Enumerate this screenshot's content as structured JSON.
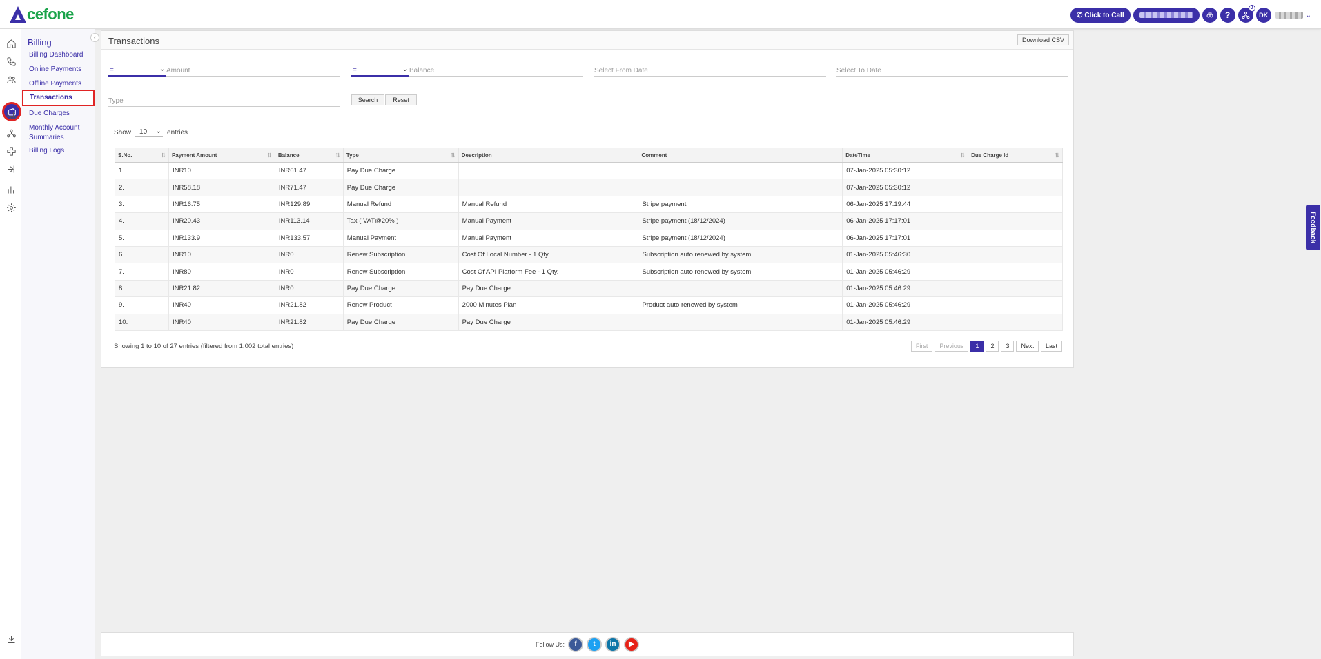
{
  "brand": {
    "logo_text": "cefone",
    "accent": "#3b2fa8",
    "logo_green": "#1aa34a"
  },
  "topbar": {
    "click_to_call": "Click to Call",
    "avatar_initials": "DK",
    "notification_count": "0"
  },
  "subnav": {
    "title": "Billing",
    "items": [
      "Billing Dashboard",
      "Online Payments",
      "Offline Payments",
      "Transactions",
      "Due Charges",
      "Monthly Account Summaries",
      "Billing Logs"
    ]
  },
  "card": {
    "title": "Transactions",
    "download_label": "Download CSV"
  },
  "filters": {
    "amount_op": "=",
    "amount_placeholder": "Amount",
    "balance_op": "=",
    "balance_placeholder": "Balance",
    "from_date_placeholder": "Select From Date",
    "to_date_placeholder": "Select To Date",
    "type_placeholder": "Type",
    "search_label": "Search",
    "reset_label": "Reset"
  },
  "length": {
    "show_label": "Show",
    "value": "10",
    "entries_label": "entries"
  },
  "table": {
    "columns": [
      "S.No.",
      "Payment Amount",
      "Balance",
      "Type",
      "Description",
      "Comment",
      "DateTime",
      "Due Charge Id"
    ],
    "rows": [
      [
        "1.",
        "INR10",
        "INR61.47",
        "Pay Due Charge",
        "",
        "",
        "07-Jan-2025 05:30:12",
        ""
      ],
      [
        "2.",
        "INR58.18",
        "INR71.47",
        "Pay Due Charge",
        "",
        "",
        "07-Jan-2025 05:30:12",
        ""
      ],
      [
        "3.",
        "INR16.75",
        "INR129.89",
        "Manual Refund",
        "Manual Refund",
        "Stripe payment",
        "06-Jan-2025 17:19:44",
        ""
      ],
      [
        "4.",
        "INR20.43",
        "INR113.14",
        "Tax ( VAT@20% )",
        "Manual Payment",
        "Stripe payment (18/12/2024)",
        "06-Jan-2025 17:17:01",
        ""
      ],
      [
        "5.",
        "INR133.9",
        "INR133.57",
        "Manual Payment",
        "Manual Payment",
        "Stripe payment (18/12/2024)",
        "06-Jan-2025 17:17:01",
        ""
      ],
      [
        "6.",
        "INR10",
        "INR0",
        "Renew Subscription",
        "Cost Of Local Number - 1 Qty.",
        "Subscription auto renewed by system",
        "01-Jan-2025 05:46:30",
        ""
      ],
      [
        "7.",
        "INR80",
        "INR0",
        "Renew Subscription",
        "Cost Of API Platform Fee - 1 Qty.",
        "Subscription auto renewed by system",
        "01-Jan-2025 05:46:29",
        ""
      ],
      [
        "8.",
        "INR21.82",
        "INR0",
        "Pay Due Charge",
        "Pay Due Charge",
        "",
        "01-Jan-2025 05:46:29",
        ""
      ],
      [
        "9.",
        "INR40",
        "INR21.82",
        "Renew Product",
        "2000 Minutes Plan",
        "Product auto renewed by system",
        "01-Jan-2025 05:46:29",
        ""
      ],
      [
        "10.",
        "INR40",
        "INR21.82",
        "Pay Due Charge",
        "Pay Due Charge",
        "",
        "01-Jan-2025 05:46:29",
        ""
      ]
    ]
  },
  "info": "Showing 1 to 10 of 27 entries (filtered from 1,002 total entries)",
  "pager": {
    "first": "First",
    "previous": "Previous",
    "pages": [
      "1",
      "2",
      "3"
    ],
    "next": "Next",
    "last": "Last"
  },
  "footer": {
    "follow_label": "Follow Us:"
  },
  "feedback_label": "Feedback"
}
